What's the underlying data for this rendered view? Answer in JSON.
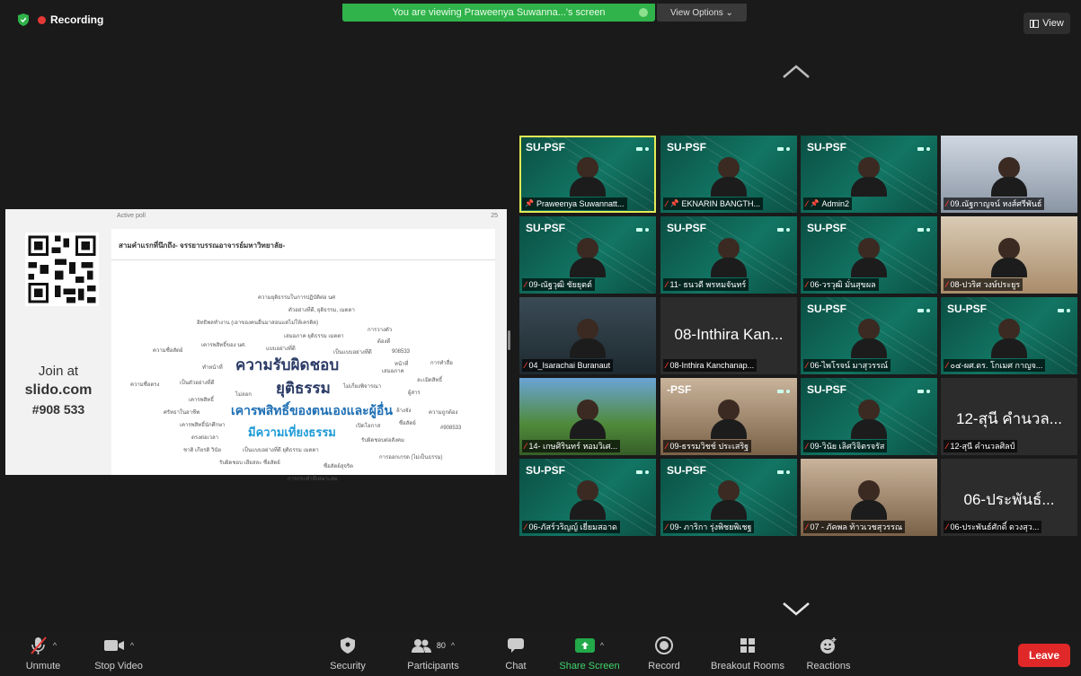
{
  "topbar": {
    "recording_label": "Recording",
    "share_banner": "You are viewing Praweenya Suwanna...'s screen",
    "view_options": "View Options ⌄",
    "view_label": "View"
  },
  "slide": {
    "join_at": "Join at",
    "site": "slido.com",
    "code": "#908 533",
    "poll_status": "Active poll",
    "poll_count": "25",
    "question": "สามคำแรกที่นึกถึง- จรรยาบรรณอาจารย์มหาวิทยาลัย-",
    "words": {
      "w1": "ความยุติธรรมในการปฏิบัติต่อ นศ",
      "w2": "ตัวอย่างที่ดี, ยุติธรรม, เมตตา",
      "w3": "อิทธิพลทำงาน (เอาของคนอื่นมาสอนแต่ไม่ให้เครดิต)",
      "w4": "การวางตัว",
      "w5": "เสมอภาค ยุติธรรม เมตตา",
      "w6": "ต้องดี",
      "w7": "ความซื่อสัตย์",
      "w8": "เคารพสิทธิ์ของ นศ.",
      "w9": "แบบอย่างที่ดี",
      "w10": "เป็นแบบอย่างที่ดี",
      "w11": "908533",
      "w12": "ทำหน้าที่",
      "w13": "ความรับผิดชอบ",
      "w14": "เสมอภาค",
      "w15": "หน้าที่",
      "w16": "การทำสื่อ",
      "w17": "ความซื่อตรง",
      "w18": "เป็นตัวอย่างที่ดี",
      "w19": "ยุติธรรม",
      "w20": "ไม่ลอก",
      "w21": "ไม่เกี่ยงพิจารณา",
      "w22": "ละเมิดสิทธิ์",
      "w23": "ผู้สาร",
      "w24": "เคารพสิทธิ์",
      "w25": "ศรัทธาในอาชีพ",
      "w26": "เคารพสิทธิ์ของตนเองและผู้อื่น",
      "w27": "ล้างจัง",
      "w28": "ความถูกต้อง",
      "w29": "เคารพสิทธิ์นักศึกษา",
      "w30": "เปิดโอกาส",
      "w31": "ซื่อสัตย์",
      "w32": "#908533",
      "w33": "มีความเที่ยงธรรม",
      "w34": "ตรงต่อเวลา",
      "w35": "รับผิดชอบต่อสังคม",
      "w36": "ชาติ เกียรติ วินัย",
      "w37": "เป็นแบบอย่างที่ดี ยุติธรรม เมตตา",
      "w38": "การออกเกรด (ไม่เป็นธรรม)",
      "w39": "รับผิดชอบ เสียสละ ซื่อสัตย์",
      "w40": "ซื่อสัตย์สุจริต",
      "w41": "การกระทำที่เหมาะสม"
    }
  },
  "tiles": [
    {
      "brand": "SU-PSF",
      "label": "Praweenya Suwannatt...",
      "pinned": true,
      "muted": false
    },
    {
      "brand": "SU-PSF",
      "label": "EKNARIN BANGTH...",
      "pinned": true,
      "muted": true
    },
    {
      "brand": "SU-PSF",
      "label": "Admin2",
      "pinned": true,
      "muted": true
    },
    {
      "brand": "",
      "label": "09.ณัฐกาญจน์ หงส์ศรีพันธ์",
      "pinned": false,
      "muted": true
    },
    {
      "brand": "SU-PSF",
      "label": "09-ณัฐวุฒิ ชัยยุตต์",
      "pinned": false,
      "muted": true
    },
    {
      "brand": "SU-PSF",
      "label": "11- ธนวดี พรหมจันทร์",
      "pinned": false,
      "muted": true
    },
    {
      "brand": "SU-PSF",
      "label": "06-วรวุฒิ มั่นสุขผล",
      "pinned": false,
      "muted": true
    },
    {
      "brand": "",
      "label": "08-ปวริศ วงษ์ประยูร",
      "pinned": false,
      "muted": true
    },
    {
      "brand": "",
      "label": "04_Isarachai Buranaut",
      "pinned": false,
      "muted": true
    },
    {
      "brand": "",
      "name": "08-Inthira Kan...",
      "label": "08-Inthira Kanchanap...",
      "pinned": false,
      "muted": true
    },
    {
      "brand": "SU-PSF",
      "label": "06-ไพโรจน์ มาสุวรรณ์",
      "pinned": false,
      "muted": true
    },
    {
      "brand": "SU-PSF",
      "label": "๐๔-ผศ.ดร. โกเมศ กาญจ...",
      "pinned": false,
      "muted": true
    },
    {
      "brand": "",
      "label": "14- เกษศิรินทร์ หอมวิเศ...",
      "pinned": false,
      "muted": true
    },
    {
      "brand": "-PSF",
      "label": "09-ธรรมวิชช์ ประเสริฐ",
      "pinned": false,
      "muted": true
    },
    {
      "brand": "SU-PSF",
      "label": "09-วินัย เลิศวิจิตรจรัส",
      "pinned": false,
      "muted": true
    },
    {
      "brand": "",
      "name": "12-สุนี คำนวล...",
      "label": "12-สุนี คำนวลศิลป์",
      "pinned": false,
      "muted": true
    },
    {
      "brand": "SU-PSF",
      "label": "06-ภัสร์วริญญ์ เยี่ยมสอาด",
      "pinned": false,
      "muted": true
    },
    {
      "brand": "SU-PSF",
      "label": "09- ภาริกา รุ่งพิชยพิเชฐ",
      "pinned": false,
      "muted": true
    },
    {
      "brand": "",
      "label": "07 - ภัคพล ท้าวเวชสุวรรณ",
      "pinned": false,
      "muted": true
    },
    {
      "brand": "",
      "name": "06-ประพันธ์...",
      "label": "06-ประพันธ์ศักดิ์ ดวงสุว...",
      "pinned": false,
      "muted": true
    }
  ],
  "toolbar": {
    "unmute": "Unmute",
    "stop_video": "Stop Video",
    "security": "Security",
    "participants": "Participants",
    "participants_count": "80",
    "chat": "Chat",
    "share_screen": "Share Screen",
    "record": "Record",
    "breakout_rooms": "Breakout Rooms",
    "reactions": "Reactions",
    "leave": "Leave"
  }
}
